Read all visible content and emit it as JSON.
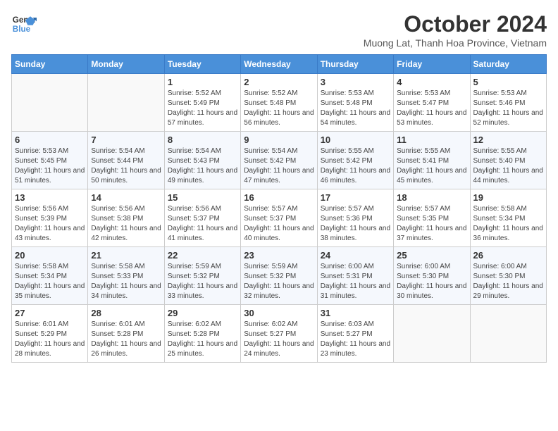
{
  "logo": {
    "line1": "General",
    "line2": "Blue"
  },
  "title": "October 2024",
  "subtitle": "Muong Lat, Thanh Hoa Province, Vietnam",
  "weekdays": [
    "Sunday",
    "Monday",
    "Tuesday",
    "Wednesday",
    "Thursday",
    "Friday",
    "Saturday"
  ],
  "weeks": [
    [
      {
        "day": "",
        "info": ""
      },
      {
        "day": "",
        "info": ""
      },
      {
        "day": "1",
        "info": "Sunrise: 5:52 AM\nSunset: 5:49 PM\nDaylight: 11 hours and 57 minutes."
      },
      {
        "day": "2",
        "info": "Sunrise: 5:52 AM\nSunset: 5:48 PM\nDaylight: 11 hours and 56 minutes."
      },
      {
        "day": "3",
        "info": "Sunrise: 5:53 AM\nSunset: 5:48 PM\nDaylight: 11 hours and 54 minutes."
      },
      {
        "day": "4",
        "info": "Sunrise: 5:53 AM\nSunset: 5:47 PM\nDaylight: 11 hours and 53 minutes."
      },
      {
        "day": "5",
        "info": "Sunrise: 5:53 AM\nSunset: 5:46 PM\nDaylight: 11 hours and 52 minutes."
      }
    ],
    [
      {
        "day": "6",
        "info": "Sunrise: 5:53 AM\nSunset: 5:45 PM\nDaylight: 11 hours and 51 minutes."
      },
      {
        "day": "7",
        "info": "Sunrise: 5:54 AM\nSunset: 5:44 PM\nDaylight: 11 hours and 50 minutes."
      },
      {
        "day": "8",
        "info": "Sunrise: 5:54 AM\nSunset: 5:43 PM\nDaylight: 11 hours and 49 minutes."
      },
      {
        "day": "9",
        "info": "Sunrise: 5:54 AM\nSunset: 5:42 PM\nDaylight: 11 hours and 47 minutes."
      },
      {
        "day": "10",
        "info": "Sunrise: 5:55 AM\nSunset: 5:42 PM\nDaylight: 11 hours and 46 minutes."
      },
      {
        "day": "11",
        "info": "Sunrise: 5:55 AM\nSunset: 5:41 PM\nDaylight: 11 hours and 45 minutes."
      },
      {
        "day": "12",
        "info": "Sunrise: 5:55 AM\nSunset: 5:40 PM\nDaylight: 11 hours and 44 minutes."
      }
    ],
    [
      {
        "day": "13",
        "info": "Sunrise: 5:56 AM\nSunset: 5:39 PM\nDaylight: 11 hours and 43 minutes."
      },
      {
        "day": "14",
        "info": "Sunrise: 5:56 AM\nSunset: 5:38 PM\nDaylight: 11 hours and 42 minutes."
      },
      {
        "day": "15",
        "info": "Sunrise: 5:56 AM\nSunset: 5:37 PM\nDaylight: 11 hours and 41 minutes."
      },
      {
        "day": "16",
        "info": "Sunrise: 5:57 AM\nSunset: 5:37 PM\nDaylight: 11 hours and 40 minutes."
      },
      {
        "day": "17",
        "info": "Sunrise: 5:57 AM\nSunset: 5:36 PM\nDaylight: 11 hours and 38 minutes."
      },
      {
        "day": "18",
        "info": "Sunrise: 5:57 AM\nSunset: 5:35 PM\nDaylight: 11 hours and 37 minutes."
      },
      {
        "day": "19",
        "info": "Sunrise: 5:58 AM\nSunset: 5:34 PM\nDaylight: 11 hours and 36 minutes."
      }
    ],
    [
      {
        "day": "20",
        "info": "Sunrise: 5:58 AM\nSunset: 5:34 PM\nDaylight: 11 hours and 35 minutes."
      },
      {
        "day": "21",
        "info": "Sunrise: 5:58 AM\nSunset: 5:33 PM\nDaylight: 11 hours and 34 minutes."
      },
      {
        "day": "22",
        "info": "Sunrise: 5:59 AM\nSunset: 5:32 PM\nDaylight: 11 hours and 33 minutes."
      },
      {
        "day": "23",
        "info": "Sunrise: 5:59 AM\nSunset: 5:32 PM\nDaylight: 11 hours and 32 minutes."
      },
      {
        "day": "24",
        "info": "Sunrise: 6:00 AM\nSunset: 5:31 PM\nDaylight: 11 hours and 31 minutes."
      },
      {
        "day": "25",
        "info": "Sunrise: 6:00 AM\nSunset: 5:30 PM\nDaylight: 11 hours and 30 minutes."
      },
      {
        "day": "26",
        "info": "Sunrise: 6:00 AM\nSunset: 5:30 PM\nDaylight: 11 hours and 29 minutes."
      }
    ],
    [
      {
        "day": "27",
        "info": "Sunrise: 6:01 AM\nSunset: 5:29 PM\nDaylight: 11 hours and 28 minutes."
      },
      {
        "day": "28",
        "info": "Sunrise: 6:01 AM\nSunset: 5:28 PM\nDaylight: 11 hours and 26 minutes."
      },
      {
        "day": "29",
        "info": "Sunrise: 6:02 AM\nSunset: 5:28 PM\nDaylight: 11 hours and 25 minutes."
      },
      {
        "day": "30",
        "info": "Sunrise: 6:02 AM\nSunset: 5:27 PM\nDaylight: 11 hours and 24 minutes."
      },
      {
        "day": "31",
        "info": "Sunrise: 6:03 AM\nSunset: 5:27 PM\nDaylight: 11 hours and 23 minutes."
      },
      {
        "day": "",
        "info": ""
      },
      {
        "day": "",
        "info": ""
      }
    ]
  ]
}
